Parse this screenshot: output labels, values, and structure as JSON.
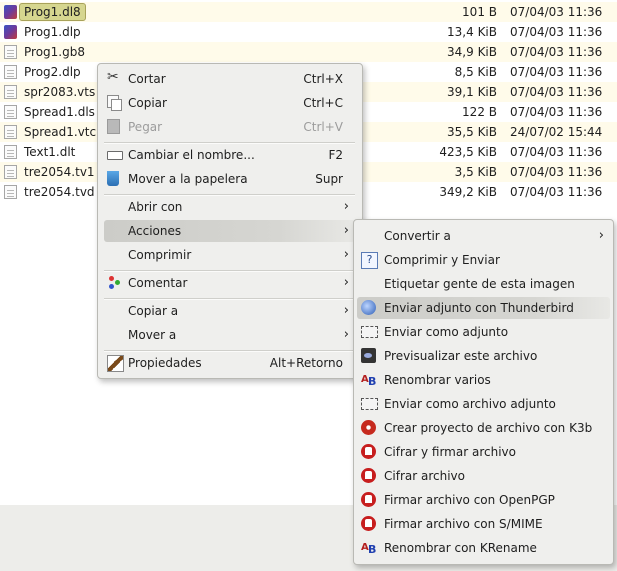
{
  "files": [
    {
      "name": "Prog1.dl8",
      "size": "101 B",
      "date": "07/04/03 11:36",
      "icon": "app-icon",
      "selected": true
    },
    {
      "name": "Prog1.dlp",
      "size": "13,4 KiB",
      "date": "07/04/03 11:36",
      "icon": "app-icon"
    },
    {
      "name": "Prog1.gb8",
      "size": "34,9 KiB",
      "date": "07/04/03 11:36",
      "icon": "document-icon"
    },
    {
      "name": "Prog2.dlp",
      "size": "8,5 KiB",
      "date": "07/04/03 11:36",
      "icon": "document-icon"
    },
    {
      "name": "spr2083.vts",
      "size": "39,1 KiB",
      "date": "07/04/03 11:36",
      "icon": "document-icon"
    },
    {
      "name": "Spread1.dls",
      "size": "122 B",
      "date": "07/04/03 11:36",
      "icon": "document-icon"
    },
    {
      "name": "Spread1.vtc",
      "size": "35,5 KiB",
      "date": "24/07/02 15:44",
      "icon": "document-icon"
    },
    {
      "name": "Text1.dlt",
      "size": "423,5 KiB",
      "date": "07/04/03 11:36",
      "icon": "document-icon"
    },
    {
      "name": "tre2054.tv1",
      "size": "3,5 KiB",
      "date": "07/04/03 11:36",
      "icon": "document-icon"
    },
    {
      "name": "tre2054.tvd",
      "size": "349,2 KiB",
      "date": "07/04/03 11:36",
      "icon": "document-icon"
    }
  ],
  "context_menu": {
    "items": [
      {
        "label": "Cortar",
        "shortcut": "Ctrl+X",
        "icon": "scissors-icon"
      },
      {
        "label": "Copiar",
        "shortcut": "Ctrl+C",
        "icon": "copy-icon"
      },
      {
        "label": "Pegar",
        "shortcut": "Ctrl+V",
        "icon": "paste-icon",
        "disabled": true
      },
      {
        "label": "Cambiar el nombre...",
        "shortcut": "F2",
        "icon": "rename-icon"
      },
      {
        "label": "Mover a la papelera",
        "shortcut": "Supr",
        "icon": "trash-icon"
      },
      {
        "label": "Abrir con",
        "submenu": true
      },
      {
        "label": "Acciones",
        "submenu": true,
        "highlighted": true
      },
      {
        "label": "Comprimir",
        "submenu": true
      },
      {
        "label": "Comentar",
        "submenu": true,
        "icon": "share-icon"
      },
      {
        "label": "Copiar a",
        "submenu": true
      },
      {
        "label": "Mover a",
        "submenu": true
      },
      {
        "label": "Propiedades",
        "shortcut": "Alt+Retorno",
        "icon": "properties-icon"
      }
    ]
  },
  "actions_submenu": {
    "items": [
      {
        "label": "Convertir a",
        "submenu": true
      },
      {
        "label": "Comprimir y Enviar",
        "icon": "help-icon"
      },
      {
        "label": "Etiquetar gente de esta imagen"
      },
      {
        "label": "Enviar adjunto con Thunderbird",
        "icon": "thunderbird-icon",
        "highlighted": true
      },
      {
        "label": "Enviar como adjunto",
        "icon": "envelope-icon"
      },
      {
        "label": "Previsualizar este archivo",
        "icon": "preview-icon"
      },
      {
        "label": "Renombrar varios",
        "icon": "rename-ab-icon"
      },
      {
        "label": "Enviar como archivo adjunto",
        "icon": "envelope-icon"
      },
      {
        "label": "Crear proyecto de archivo con K3b",
        "icon": "k3b-icon"
      },
      {
        "label": "Cifrar y firmar archivo",
        "icon": "kgpg-icon"
      },
      {
        "label": "Cifrar archivo",
        "icon": "kgpg-icon"
      },
      {
        "label": "Firmar archivo con OpenPGP",
        "icon": "kgpg-icon"
      },
      {
        "label": "Firmar archivo con S/MIME",
        "icon": "kgpg-icon"
      },
      {
        "label": "Renombrar con KRename",
        "icon": "rename-ab-icon"
      }
    ]
  },
  "colors": {
    "row_alt": "#fffbea",
    "selection": "#d6d68f",
    "menu_bg": "#efefed",
    "highlight": "#d0d0cc"
  }
}
